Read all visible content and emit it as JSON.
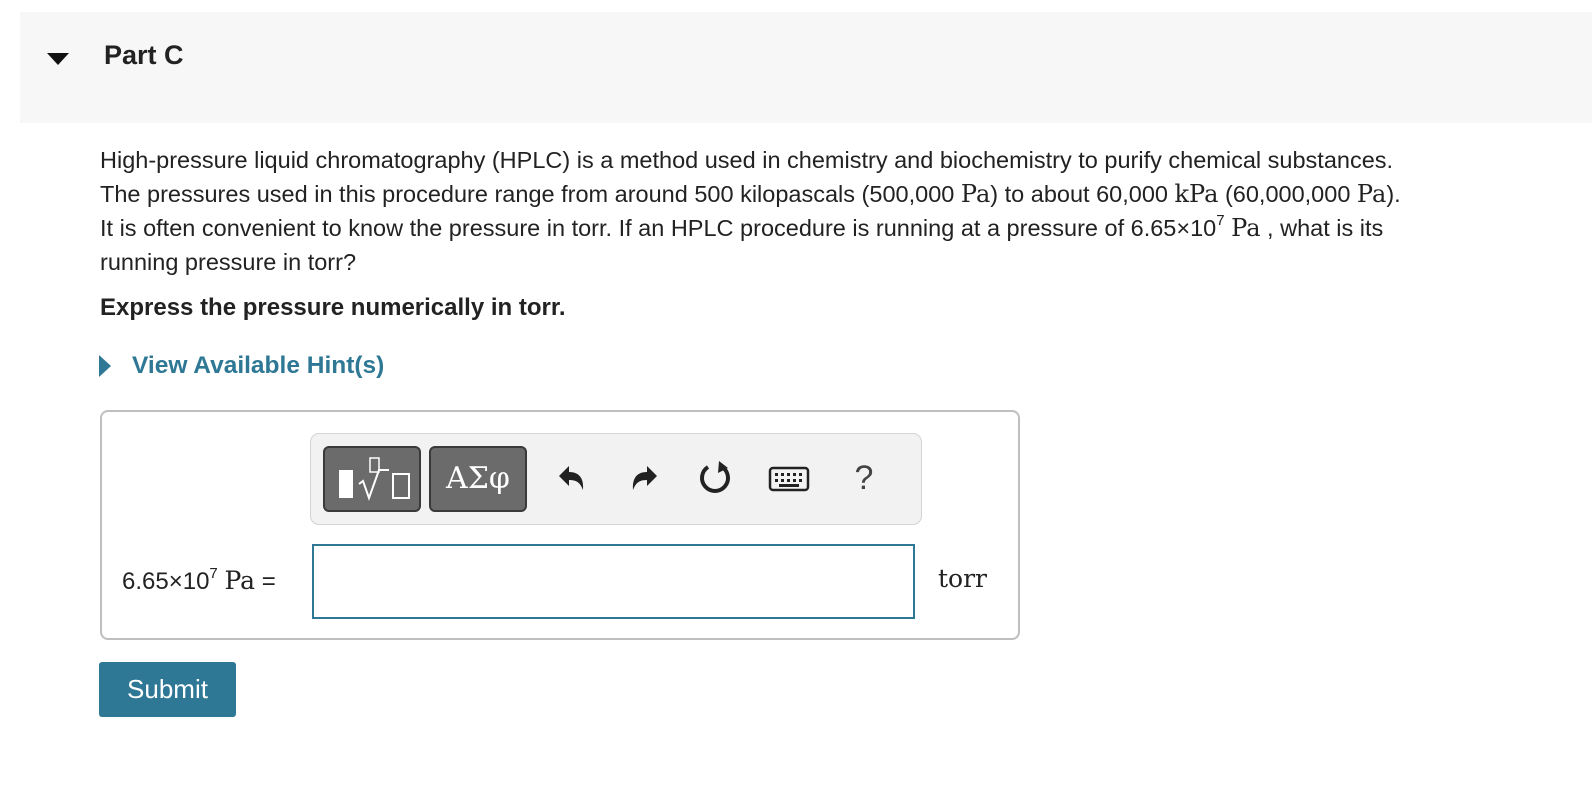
{
  "part": {
    "title": "Part C"
  },
  "question": {
    "line1": "High-pressure liquid chromatography (HPLC) is a method used in chemistry and biochemistry to purify chemical substances.",
    "line2_a": "The pressures used in this procedure range from around 500 kilopascals (500,000 ",
    "unit_pa": "Pa",
    "line2_b": ") to about 60,000 ",
    "unit_kpa": "kPa",
    "line2_c": " (60,000,000 ",
    "line2_d": ").",
    "line3_a": "It is often convenient to know the pressure in torr. If an HPLC procedure is running at a pressure of 6.65×10",
    "exponent": "7",
    "line3_b": " , what is its",
    "line4": "running pressure in torr?"
  },
  "instruction": "Express the pressure numerically in torr.",
  "hints": {
    "label": "View Available Hint(s)"
  },
  "toolbar": {
    "templates_icon": "templates-icon",
    "greek_label": "ΑΣφ",
    "undo_icon": "undo-icon",
    "redo_icon": "redo-icon",
    "reset_icon": "reset-icon",
    "keyboard_icon": "keyboard-icon",
    "help_label": "?"
  },
  "answer": {
    "lhs_mantissa": "6.65×10",
    "lhs_exponent": "7",
    "lhs_unit": "Pa",
    "equals": "=",
    "value": "",
    "unit": "torr"
  },
  "submit": {
    "label": "Submit"
  },
  "colors": {
    "accent": "#2e7896",
    "header_bg": "#f7f7f7",
    "toolbar_bg": "#f2f2f2",
    "button_dark": "#6b6b6b"
  }
}
